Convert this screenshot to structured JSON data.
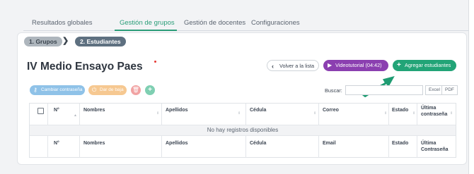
{
  "tabs": [
    "Resultados globales",
    "Gestión de grupos",
    "Gestión de docentes",
    "Configuraciones"
  ],
  "active_tab_index": 1,
  "steps": {
    "step1": "1. Grupos",
    "step2": "2. Estudiantes"
  },
  "page_title": "IV Medio Ensayo Paes",
  "buttons": {
    "back": "Volver a la lista",
    "video": "Videotutorial (04:42)",
    "add": "Agregar estudiantes",
    "change_password": "Cambiar contraseña",
    "deactivate": "Dar de baja"
  },
  "search": {
    "label": "Buscar:",
    "value": ""
  },
  "export": {
    "excel": "Excel",
    "pdf": "PDF"
  },
  "table": {
    "header": {
      "num": "N°",
      "nombres": "Nombres",
      "apellidos": "Apellidos",
      "cedula": "Cédula",
      "correo": "Correo",
      "estado": "Estado",
      "ultima_1": "Última",
      "ultima_2": "contraseña"
    },
    "empty_message": "No hay registros disponibles",
    "footer": {
      "num": "N°",
      "nombres": "Nombres",
      "apellidos": "Apellidos",
      "cedula": "Cédula",
      "email": "Email",
      "estado": "Estado",
      "ultima_1": "Última",
      "ultima_2": "Contraseña"
    }
  },
  "colors": {
    "accent": "#22a477",
    "video": "#8b3fb0",
    "arrow": "#1f9c72",
    "step_active": "#5e7080"
  }
}
